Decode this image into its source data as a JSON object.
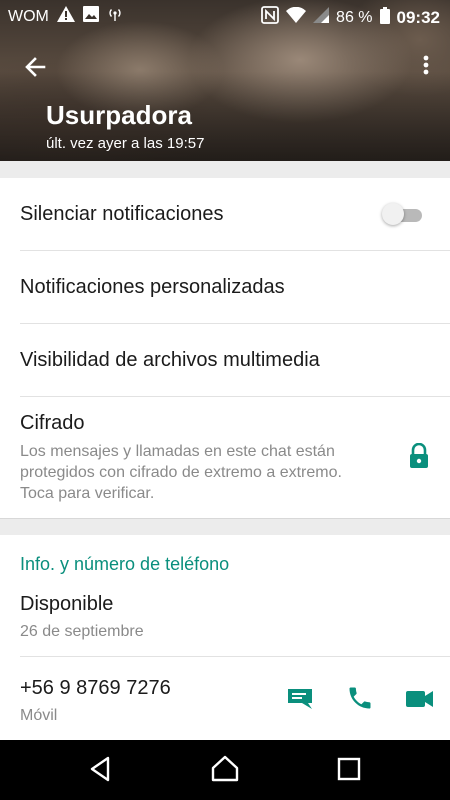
{
  "status_bar": {
    "carrier": "WOM",
    "battery": "86 %",
    "time": "09:32"
  },
  "contact": {
    "name": "Usurpadora",
    "last_seen": "últ. vez ayer a las 19:57"
  },
  "settings": {
    "mute_label": "Silenciar notificaciones",
    "mute_enabled": false,
    "custom_notifications_label": "Notificaciones personalizadas",
    "media_visibility_label": "Visibilidad de archivos multimedia",
    "encryption_title": "Cifrado",
    "encryption_line1": "Los mensajes y llamadas en este chat están",
    "encryption_line2": "protegidos con cifrado de extremo a extremo.",
    "encryption_line3": "Toca para verificar."
  },
  "info": {
    "section_title": "Info. y número de teléfono",
    "status_text": "Disponible",
    "status_date": "26 de septiembre",
    "phone_number": "+56 9 8769 7276",
    "phone_type": "Móvil"
  },
  "colors": {
    "accent": "#0a8f7d",
    "divider": "#e2e2e2"
  },
  "icons": [
    "warning-icon",
    "image-icon",
    "hotspot-icon",
    "nfc-icon",
    "wifi-icon",
    "signal-icon",
    "battery-icon",
    "back-arrow-icon",
    "more-vert-icon",
    "lock-icon",
    "message-icon",
    "phone-icon",
    "video-icon",
    "nav-back-icon",
    "nav-home-icon",
    "nav-recents-icon"
  ]
}
